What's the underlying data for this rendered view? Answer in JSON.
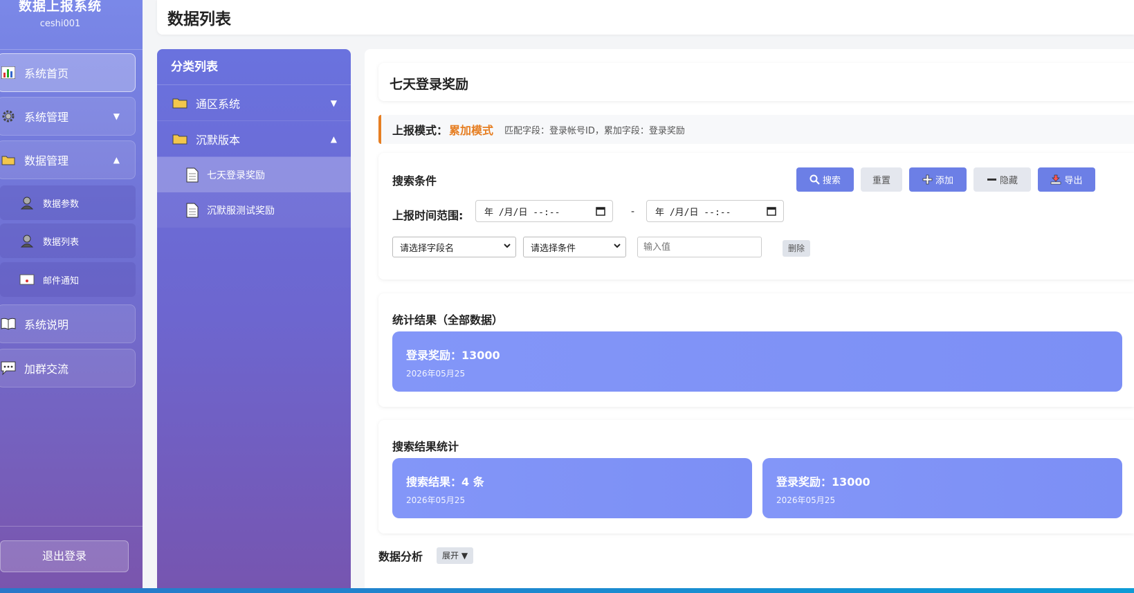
{
  "app": {
    "title": "数据上报系统",
    "username": "ceshi001"
  },
  "sidebar": {
    "items": [
      {
        "label": "系统首页",
        "icon": "bar-chart-icon"
      },
      {
        "label": "系统管理",
        "icon": "gear-icon",
        "arrow": "▼"
      },
      {
        "label": "数据管理",
        "icon": "folder-icon",
        "arrow": "▲"
      },
      {
        "label": "数据参数",
        "icon": "user-icon"
      },
      {
        "label": "数据列表",
        "icon": "user-icon"
      },
      {
        "label": "邮件通知",
        "icon": "mail-icon"
      },
      {
        "label": "系统说明",
        "icon": "book-icon"
      },
      {
        "label": "加群交流",
        "icon": "chat-icon"
      }
    ],
    "logout": "退出登录"
  },
  "header": {
    "title": "数据列表"
  },
  "categories": {
    "title": "分类列表",
    "groups": [
      {
        "label": "通区系统",
        "arrow": "▼"
      },
      {
        "label": "沉默版本",
        "arrow": "▲"
      }
    ],
    "sub_items": [
      {
        "label": "七天登录奖励"
      },
      {
        "label": "沉默服测试奖励"
      }
    ]
  },
  "main": {
    "title": "七天登录奖励",
    "mode": {
      "label": "上报模式：",
      "value": "累加模式",
      "desc": "匹配字段：登录帐号ID，累加字段：登录奖励"
    },
    "search": {
      "title": "搜索条件",
      "buttons": {
        "search": "搜索",
        "reset": "重置",
        "add": "添加",
        "hide": "隐藏",
        "export": "导出"
      },
      "range_label": "上报时间范围:",
      "date_from": "年 /月/日 --:--",
      "date_to": "年 /月/日 --:--",
      "dash": "-",
      "field_select": "请选择字段名",
      "cond_select": "请选择条件",
      "value_placeholder": "输入值",
      "delete": "删除"
    },
    "stats": {
      "title": "统计结果（全部数据）",
      "box": {
        "value": "登录奖励：13000",
        "date": "2026年05月25"
      }
    },
    "results": {
      "title": "搜索结果统计",
      "boxes": [
        {
          "value": "搜索结果：4 条",
          "date": "2026年05月25"
        },
        {
          "value": "登录奖励：13000",
          "date": "2026年05月25"
        }
      ]
    },
    "analysis": {
      "title": "数据分析",
      "expand": "展开 ▼"
    }
  },
  "colors": {
    "accent": "#6c7fe6",
    "mode": "#e67e22",
    "stat": "#8396f8"
  }
}
